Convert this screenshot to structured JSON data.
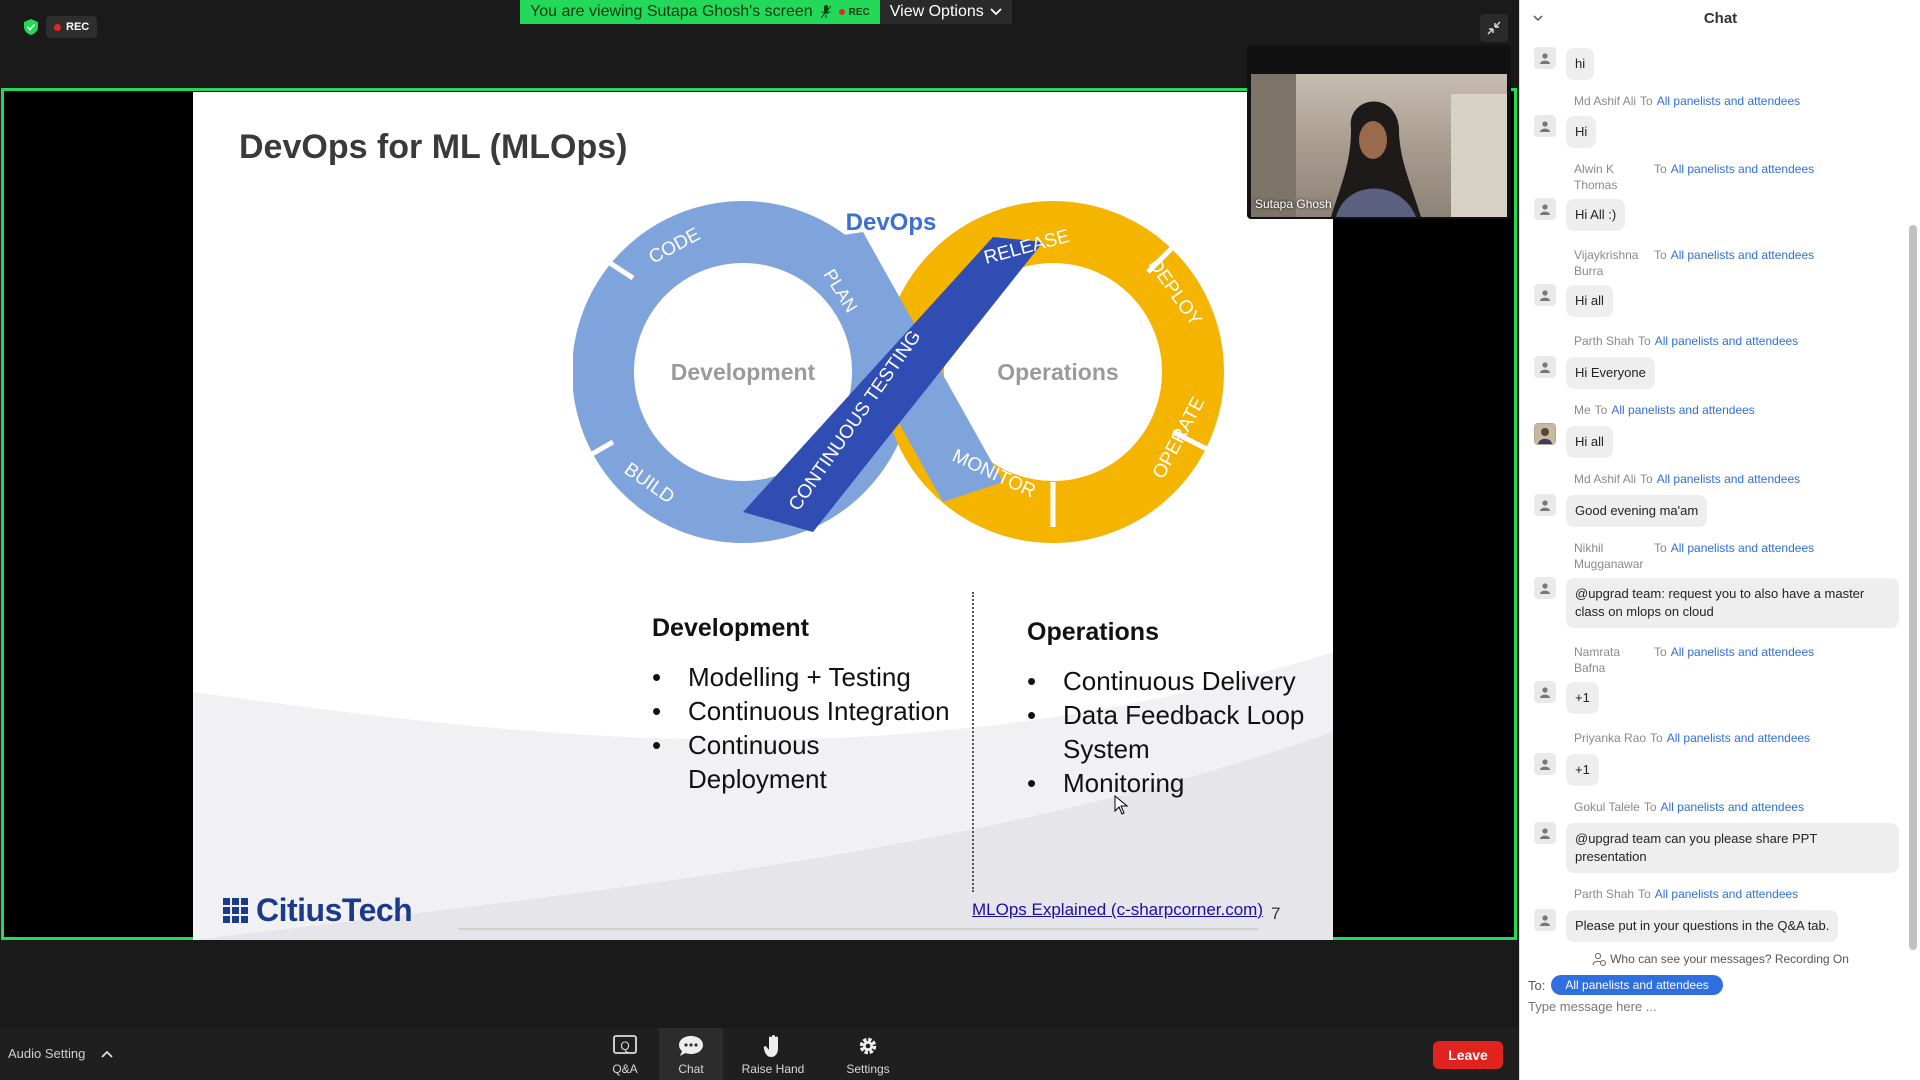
{
  "recording": {
    "label": "REC"
  },
  "share_banner": {
    "viewing_text": "You are viewing Sutapa Ghosh's screen",
    "rec_label": "REC",
    "view_options_label": "View Options"
  },
  "slide": {
    "title": "DevOps for ML (MLOps)",
    "diagram": {
      "center_label": "DevOps",
      "left_label": "Development",
      "right_label": "Operations",
      "stages": [
        "CODE",
        "BUILD",
        "PLAN",
        "CONTINUOUS TESTING",
        "RELEASE",
        "DEPLOY",
        "OPERATE",
        "MONITOR"
      ]
    },
    "left_column": {
      "heading": "Development",
      "items": [
        "Modelling + Testing",
        "Continuous Integration",
        "Continuous",
        "Deployment"
      ]
    },
    "right_column": {
      "heading": "Operations",
      "items": [
        "Continuous Delivery",
        "Data Feedback Loop",
        "System",
        "Monitoring"
      ]
    },
    "logo_text": "CitiusTech",
    "link_text": "MLOps Explained (c-sharpcorner.com)",
    "page_number": "7",
    "colors": {
      "blue_light": "#7fa4dc",
      "blue_dark": "#2f4db3",
      "gold": "#f5b400"
    }
  },
  "speaker": {
    "name": "Sutapa Ghosh"
  },
  "toolbar": {
    "audio_setting_label": "Audio Setting",
    "qa_label": "Q&A",
    "chat_label": "Chat",
    "raise_hand_label": "Raise Hand",
    "settings_label": "Settings",
    "leave_label": "Leave"
  },
  "chat": {
    "title": "Chat",
    "messages": [
      {
        "sender": "",
        "to": "",
        "recipient": "",
        "text": "hi"
      },
      {
        "sender": "Md Ashif Ali",
        "to": "To",
        "recipient": "All panelists and attendees",
        "text": "Hi"
      },
      {
        "sender": "Alwin K Thomas",
        "to": "To",
        "recipient": "All panelists and attendees",
        "text": "Hi All :)"
      },
      {
        "sender": "Vijaykrishna Burra",
        "to": "To",
        "recipient": "All panelists and attendees",
        "text": "Hi all"
      },
      {
        "sender": "Parth Shah",
        "to": "To",
        "recipient": "All panelists and attendees",
        "text": "Hi Everyone"
      },
      {
        "sender": "Me",
        "to": "To",
        "recipient": "All panelists and attendees",
        "text": "Hi all"
      },
      {
        "sender": "Md Ashif Ali",
        "to": "To",
        "recipient": "All panelists and attendees",
        "text": "Good evening ma'am"
      },
      {
        "sender": "Nikhil Mugganawar",
        "to": "To",
        "recipient": "All panelists and attendees",
        "text": "@upgrad team: request you to also have a master class on mlops on cloud"
      },
      {
        "sender": "Namrata Bafna",
        "to": "To",
        "recipient": "All panelists and attendees",
        "text": "+1"
      },
      {
        "sender": "Priyanka Rao",
        "to": "To",
        "recipient": "All panelists and attendees",
        "text": "+1"
      },
      {
        "sender": "Gokul Talele",
        "to": "To",
        "recipient": "All panelists and attendees",
        "text": "@upgrad team can you please share PPT presentation"
      },
      {
        "sender": "Parth Shah",
        "to": "To",
        "recipient": "All panelists and attendees",
        "text": "Please put in your questions in the Q&A tab."
      }
    ],
    "privacy_note": "Who can see your messages? Recording On",
    "to_label": "To:",
    "to_value": "All panelists and attendees",
    "input_placeholder": "Type message here ..."
  }
}
